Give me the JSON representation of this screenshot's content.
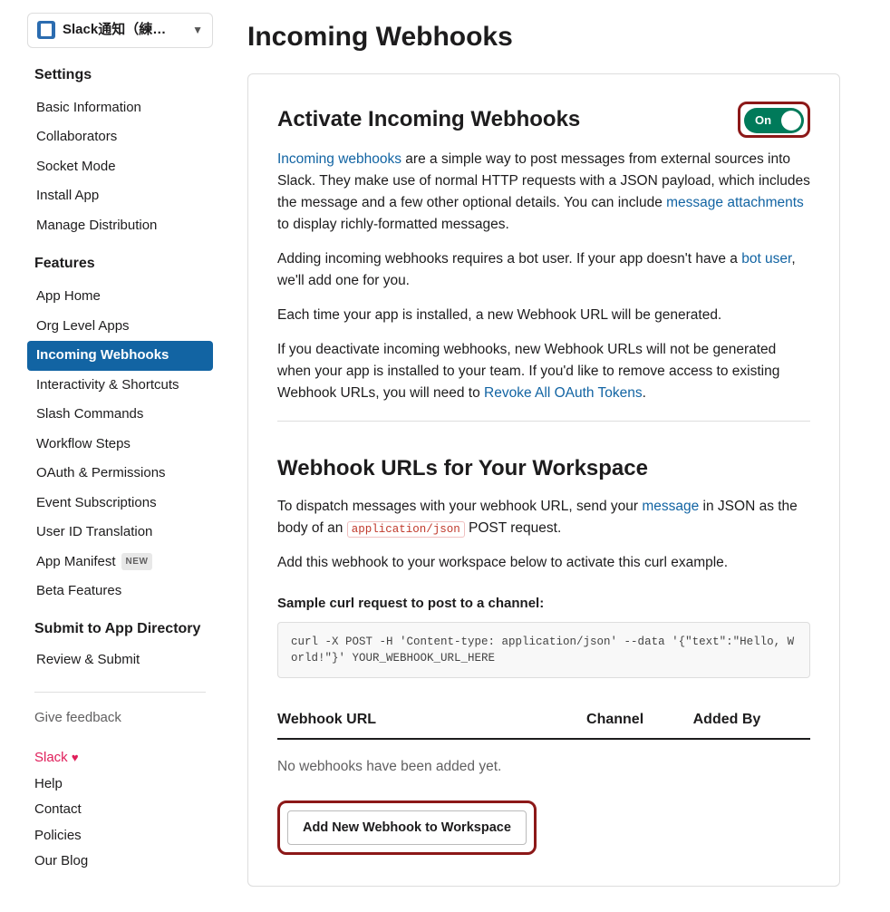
{
  "app_selector": {
    "label": "Slack通知（練…"
  },
  "sidebar": {
    "settings_heading": "Settings",
    "settings_items": [
      {
        "label": "Basic Information"
      },
      {
        "label": "Collaborators"
      },
      {
        "label": "Socket Mode"
      },
      {
        "label": "Install App"
      },
      {
        "label": "Manage Distribution"
      }
    ],
    "features_heading": "Features",
    "features_items": [
      {
        "label": "App Home"
      },
      {
        "label": "Org Level Apps"
      },
      {
        "label": "Incoming Webhooks",
        "active": true
      },
      {
        "label": "Interactivity & Shortcuts"
      },
      {
        "label": "Slash Commands"
      },
      {
        "label": "Workflow Steps"
      },
      {
        "label": "OAuth & Permissions"
      },
      {
        "label": "Event Subscriptions"
      },
      {
        "label": "User ID Translation"
      },
      {
        "label": "App Manifest",
        "badge": "NEW"
      },
      {
        "label": "Beta Features"
      }
    ],
    "submit_heading": "Submit to App Directory",
    "submit_items": [
      {
        "label": "Review & Submit"
      }
    ],
    "feedback": "Give feedback",
    "footer": [
      {
        "label": "Slack",
        "brand": true
      },
      {
        "label": "Help"
      },
      {
        "label": "Contact"
      },
      {
        "label": "Policies"
      },
      {
        "label": "Our Blog"
      }
    ]
  },
  "page_title": "Incoming Webhooks",
  "activate": {
    "title": "Activate Incoming Webhooks",
    "toggle_label": "On",
    "link_intro": "Incoming webhooks",
    "p1_rest": " are a simple way to post messages from external sources into Slack. They make use of normal HTTP requests with a JSON payload, which includes the message and a few other optional details. You can include ",
    "link_attach": "message attachments",
    "p1_tail": " to display richly-formatted messages.",
    "p2_pre": "Adding incoming webhooks requires a bot user. If your app doesn't have a ",
    "link_bot": "bot user",
    "p2_post": ", we'll add one for you.",
    "p3": "Each time your app is installed, a new Webhook URL will be generated.",
    "p4_pre": "If you deactivate incoming webhooks, new Webhook URLs will not be generated when your app is installed to your team. If you'd like to remove access to existing Webhook URLs, you will need to ",
    "link_revoke": "Revoke All OAuth Tokens",
    "p4_post": "."
  },
  "webhooks": {
    "title": "Webhook URLs for Your Workspace",
    "p1_pre": "To dispatch messages with your webhook URL, send your ",
    "link_msg": "message",
    "p1_mid": " in JSON as the body of an ",
    "code_ct": "application/json",
    "p1_post": " POST request.",
    "p2": "Add this webhook to your workspace below to activate this curl example.",
    "sample_label": "Sample curl request to post to a channel:",
    "code": "curl -X POST -H 'Content-type: application/json' --data '{\"text\":\"Hello, World!\"}' YOUR_WEBHOOK_URL_HERE",
    "headers": {
      "url": "Webhook URL",
      "channel": "Channel",
      "added": "Added By"
    },
    "empty": "No webhooks have been added yet.",
    "add_button": "Add New Webhook to Workspace"
  }
}
